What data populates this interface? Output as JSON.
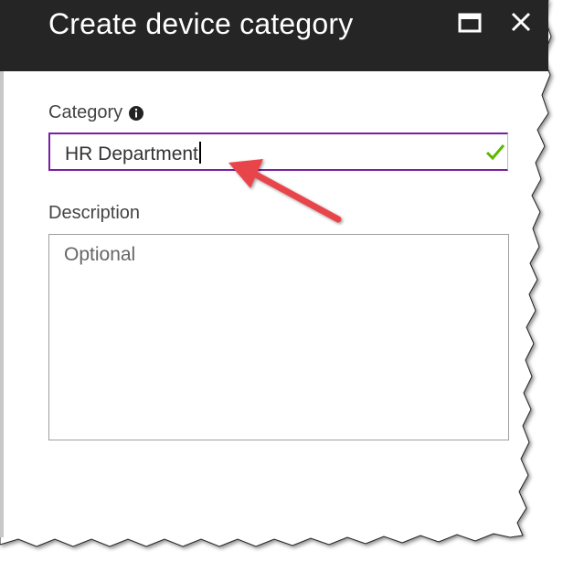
{
  "dialog": {
    "title": "Create device category"
  },
  "category": {
    "label": "Category",
    "value": "HR Department",
    "valid": true
  },
  "description": {
    "label": "Description",
    "placeholder": "Optional",
    "value": ""
  },
  "icons": {
    "maximize": "maximize-icon",
    "close": "close-icon",
    "info": "info-icon",
    "valid": "checkmark-icon",
    "annotation": "arrow-annotation"
  },
  "colors": {
    "header_bg": "#252525",
    "input_focus_border": "#7b1fa2",
    "check_green": "#5cb800",
    "arrow_red": "#e8454c"
  }
}
